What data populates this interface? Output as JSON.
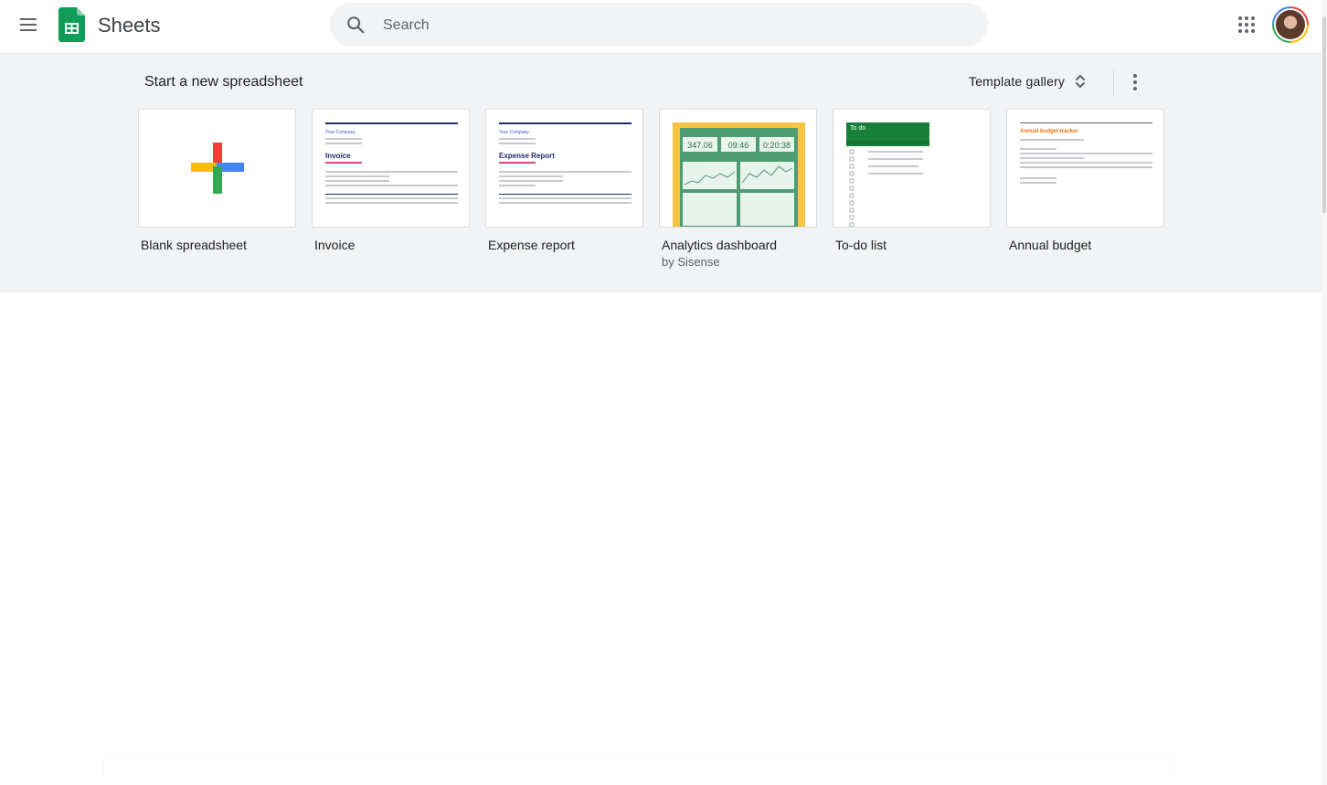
{
  "header": {
    "app_name": "Sheets",
    "search": {
      "placeholder": "Search",
      "value": ""
    },
    "icons": [
      "main-menu-icon",
      "sheets-logo-icon",
      "search-icon",
      "google-apps-icon",
      "account-avatar"
    ]
  },
  "templates": {
    "section_title": "Start a new spreadsheet",
    "gallery_label": "Template gallery",
    "items": [
      {
        "name": "Blank spreadsheet",
        "sub": ""
      },
      {
        "name": "Invoice",
        "sub": ""
      },
      {
        "name": "Expense report",
        "sub": ""
      },
      {
        "name": "Analytics dashboard",
        "sub": "by Sisense"
      },
      {
        "name": "To-do list",
        "sub": ""
      },
      {
        "name": "Annual budget",
        "sub": ""
      }
    ],
    "thumbnails": {
      "invoice": {
        "company": "Your Company",
        "heading": "Invoice"
      },
      "expense": {
        "company": "Your Company",
        "heading": "Expense Report"
      },
      "analytics": {
        "metric_1": "347.06",
        "metric_2": "09:46",
        "metric_3": "0:20:38"
      },
      "todo": {
        "heading": "To do"
      },
      "budget": {
        "heading": "Annual budget tracker"
      }
    }
  },
  "colors": {
    "sheets_green": "#0f9d58",
    "google_red": "#ea4335",
    "google_yellow": "#fbbc04",
    "google_blue": "#4285f4",
    "section_bg": "#f1f3f4"
  }
}
